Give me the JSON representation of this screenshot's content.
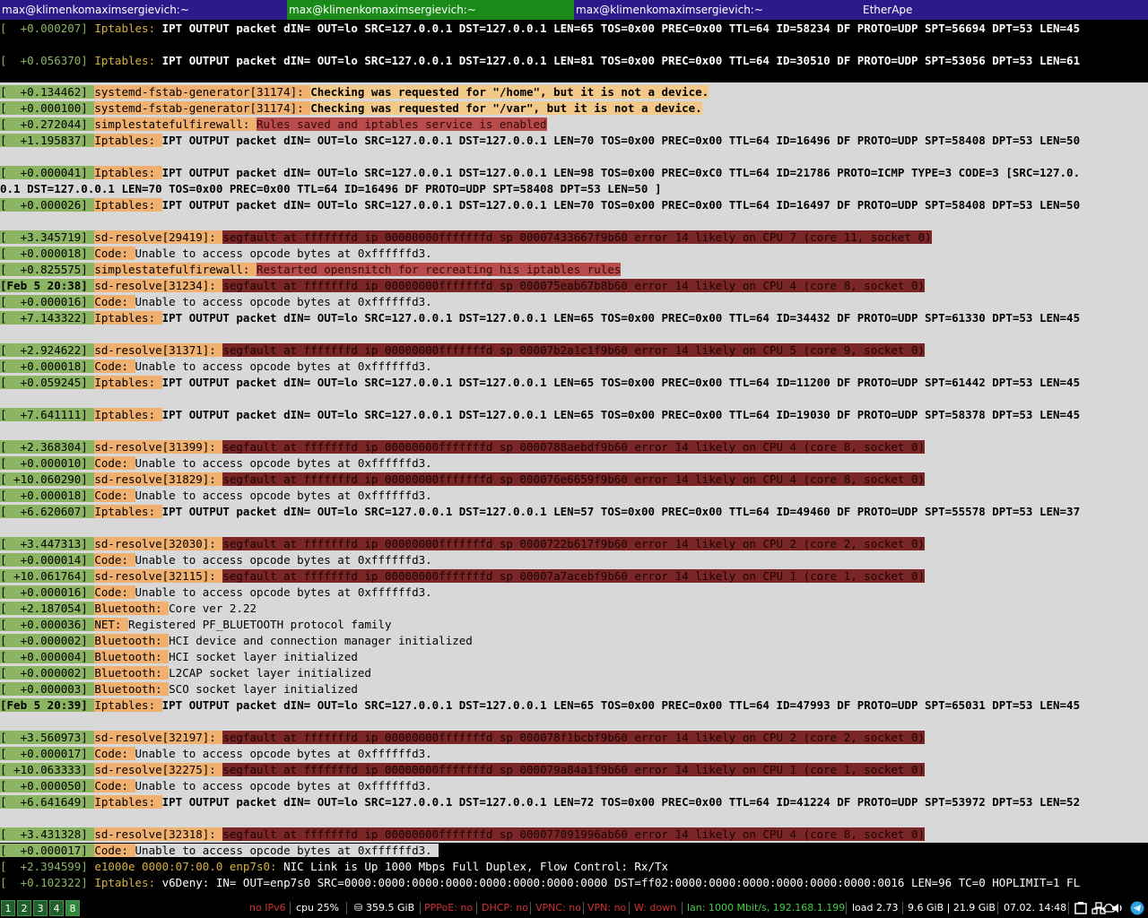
{
  "tabs": [
    {
      "title": "max@klimenkomaximsergievich:~"
    },
    {
      "title": "max@klimenkomaximsergievich:~"
    },
    {
      "title": "max@klimenkomaximsergievich:~"
    },
    {
      "title": "EtherApe"
    }
  ],
  "log": {
    "l0": {
      "ts": "[  +0.000207] ",
      "fac": "Iptables: ",
      "msg": "IPT OUTPUT packet dIN= OUT=lo SRC=127.0.0.1 DST=127.0.0.1 LEN=65 TOS=0x00 PREC=0x00 TTL=64 ID=58234 DF PROTO=UDP SPT=56694 DPT=53 LEN=45"
    },
    "l1": {
      "ts": "[  +0.056370] ",
      "fac": "Iptables: ",
      "msg": "IPT OUTPUT packet dIN= OUT=lo SRC=127.0.0.1 DST=127.0.0.1 LEN=81 TOS=0x00 PREC=0x00 TTL=64 ID=30510 DF PROTO=UDP SPT=53056 DPT=53 LEN=61"
    },
    "l2": {
      "ts": "[  +0.134462] ",
      "fac": "systemd-fstab-generator[31174]: ",
      "msg": "Checking was requested for \"/home\", but it is not a device."
    },
    "l3": {
      "ts": "[  +0.000100] ",
      "fac": "systemd-fstab-generator[31174]: ",
      "msg": "Checking was requested for \"/var\", but it is not a device."
    },
    "l4": {
      "ts": "[  +0.272044] ",
      "fac": "simplestatefulfirewall: ",
      "msg": "Rules saved and iptables service is enabled"
    },
    "l5": {
      "ts": "[  +1.195837] ",
      "fac": "Iptables: ",
      "msg": "IPT OUTPUT packet dIN= OUT=lo SRC=127.0.0.1 DST=127.0.0.1 LEN=70 TOS=0x00 PREC=0x00 TTL=64 ID=16496 DF PROTO=UDP SPT=58408 DPT=53 LEN=50"
    },
    "l6": {
      "ts": "[  +0.000041] ",
      "fac": "Iptables: ",
      "msg": "IPT OUTPUT packet dIN= OUT=lo SRC=127.0.0.1 DST=127.0.0.1 LEN=98 TOS=0x00 PREC=0xC0 TTL=64 ID=21786 PROTO=ICMP TYPE=3 CODE=3 [SRC=127.0."
    },
    "l6b": {
      "msg": "0.1 DST=127.0.0.1 LEN=70 TOS=0x00 PREC=0x00 TTL=64 ID=16496 DF PROTO=UDP SPT=58408 DPT=53 LEN=50 ]"
    },
    "l7": {
      "ts": "[  +0.000026] ",
      "fac": "Iptables: ",
      "msg": "IPT OUTPUT packet dIN= OUT=lo SRC=127.0.0.1 DST=127.0.0.1 LEN=70 TOS=0x00 PREC=0x00 TTL=64 ID=16497 DF PROTO=UDP SPT=58408 DPT=53 LEN=50"
    },
    "l8": {
      "ts": "[  +3.345719] ",
      "fac": "sd-resolve[29419]: ",
      "msg": "segfault at fffffffd ip 00000000fffffffd sp 00007433667f9b60 error 14 likely on CPU 7 (core 11, socket 0)"
    },
    "l9": {
      "ts": "[  +0.000018] ",
      "fac": "Code: ",
      "msg": "Unable to access opcode bytes at 0xffffffd3."
    },
    "l10": {
      "ts": "[  +0.825575] ",
      "fac": "simplestatefulfirewall: ",
      "msg": "Restarted opensnitch for recreating his iptables rules"
    },
    "l11": {
      "ts": "[Feb 5 20:38] ",
      "fac": "sd-resolve[31234]: ",
      "msg": "segfault at fffffffd ip 00000000fffffffd sp 000075eab67b8b60 error 14 likely on CPU 4 (core 8, socket 0)"
    },
    "l12": {
      "ts": "[  +0.000016] ",
      "fac": "Code: ",
      "msg": "Unable to access opcode bytes at 0xffffffd3."
    },
    "l13": {
      "ts": "[  +7.143322] ",
      "fac": "Iptables: ",
      "msg": "IPT OUTPUT packet dIN= OUT=lo SRC=127.0.0.1 DST=127.0.0.1 LEN=65 TOS=0x00 PREC=0x00 TTL=64 ID=34432 DF PROTO=UDP SPT=61330 DPT=53 LEN=45"
    },
    "l14": {
      "ts": "[  +2.924622] ",
      "fac": "sd-resolve[31371]: ",
      "msg": "segfault at fffffffd ip 00000000fffffffd sp 00007b2a1c1f9b60 error 14 likely on CPU 5 (core 9, socket 0)"
    },
    "l15": {
      "ts": "[  +0.000018] ",
      "fac": "Code: ",
      "msg": "Unable to access opcode bytes at 0xffffffd3."
    },
    "l16": {
      "ts": "[  +0.059245] ",
      "fac": "Iptables: ",
      "msg": "IPT OUTPUT packet dIN= OUT=lo SRC=127.0.0.1 DST=127.0.0.1 LEN=65 TOS=0x00 PREC=0x00 TTL=64 ID=11200 DF PROTO=UDP SPT=61442 DPT=53 LEN=45"
    },
    "l17": {
      "ts": "[  +7.641111] ",
      "fac": "Iptables: ",
      "msg": "IPT OUTPUT packet dIN= OUT=lo SRC=127.0.0.1 DST=127.0.0.1 LEN=65 TOS=0x00 PREC=0x00 TTL=64 ID=19030 DF PROTO=UDP SPT=58378 DPT=53 LEN=45"
    },
    "l18": {
      "ts": "[  +2.368304] ",
      "fac": "sd-resolve[31399]: ",
      "msg": "segfault at fffffffd ip 00000000fffffffd sp 0000788aebdf9b60 error 14 likely on CPU 4 (core 8, socket 0)"
    },
    "l19": {
      "ts": "[  +0.000010] ",
      "fac": "Code: ",
      "msg": "Unable to access opcode bytes at 0xffffffd3."
    },
    "l20": {
      "ts": "[ +10.060290] ",
      "fac": "sd-resolve[31829]: ",
      "msg": "segfault at fffffffd ip 00000000fffffffd sp 000076e6659f9b60 error 14 likely on CPU 4 (core 8, socket 0)"
    },
    "l21": {
      "ts": "[  +0.000018] ",
      "fac": "Code: ",
      "msg": "Unable to access opcode bytes at 0xffffffd3."
    },
    "l22": {
      "ts": "[  +6.620607] ",
      "fac": "Iptables: ",
      "msg": "IPT OUTPUT packet dIN= OUT=lo SRC=127.0.0.1 DST=127.0.0.1 LEN=57 TOS=0x00 PREC=0x00 TTL=64 ID=49460 DF PROTO=UDP SPT=55578 DPT=53 LEN=37"
    },
    "l23": {
      "ts": "[  +3.447313] ",
      "fac": "sd-resolve[32030]: ",
      "msg": "segfault at fffffffd ip 00000000fffffffd sp 0000722b617f9b60 error 14 likely on CPU 2 (core 2, socket 0)"
    },
    "l24": {
      "ts": "[  +0.000014] ",
      "fac": "Code: ",
      "msg": "Unable to access opcode bytes at 0xffffffd3."
    },
    "l25": {
      "ts": "[ +10.061764] ",
      "fac": "sd-resolve[32115]: ",
      "msg": "segfault at fffffffd ip 00000000fffffffd sp 00007a7acebf9b60 error 14 likely on CPU 1 (core 1, socket 0)"
    },
    "l26": {
      "ts": "[  +0.000016] ",
      "fac": "Code: ",
      "msg": "Unable to access opcode bytes at 0xffffffd3."
    },
    "l27": {
      "ts": "[  +2.187054] ",
      "fac": "Bluetooth: ",
      "msg": "Core ver 2.22"
    },
    "l28": {
      "ts": "[  +0.000036] ",
      "fac": "NET: ",
      "msg": "Registered PF_BLUETOOTH protocol family"
    },
    "l29": {
      "ts": "[  +0.000002] ",
      "fac": "Bluetooth: ",
      "msg": "HCI device and connection manager initialized"
    },
    "l30": {
      "ts": "[  +0.000004] ",
      "fac": "Bluetooth: ",
      "msg": "HCI socket layer initialized"
    },
    "l31": {
      "ts": "[  +0.000002] ",
      "fac": "Bluetooth: ",
      "msg": "L2CAP socket layer initialized"
    },
    "l32": {
      "ts": "[  +0.000003] ",
      "fac": "Bluetooth: ",
      "msg": "SCO socket layer initialized"
    },
    "l33": {
      "ts": "[Feb 5 20:39] ",
      "fac": "Iptables: ",
      "msg": "IPT OUTPUT packet dIN= OUT=lo SRC=127.0.0.1 DST=127.0.0.1 LEN=65 TOS=0x00 PREC=0x00 TTL=64 ID=47993 DF PROTO=UDP SPT=65031 DPT=53 LEN=45"
    },
    "l34": {
      "ts": "[  +3.560973] ",
      "fac": "sd-resolve[32197]: ",
      "msg": "segfault at fffffffd ip 00000000fffffffd sp 000078f1bcbf9b60 error 14 likely on CPU 2 (core 2, socket 0)"
    },
    "l35": {
      "ts": "[  +0.000017] ",
      "fac": "Code: ",
      "msg": "Unable to access opcode bytes at 0xffffffd3."
    },
    "l36": {
      "ts": "[ +10.063333] ",
      "fac": "sd-resolve[32275]: ",
      "msg": "segfault at fffffffd ip 00000000fffffffd sp 000079a84a1f9b60 error 14 likely on CPU 1 (core 1, socket 0)"
    },
    "l37": {
      "ts": "[  +0.000050] ",
      "fac": "Code: ",
      "msg": "Unable to access opcode bytes at 0xffffffd3."
    },
    "l38": {
      "ts": "[  +6.641649] ",
      "fac": "Iptables: ",
      "msg": "IPT OUTPUT packet dIN= OUT=lo SRC=127.0.0.1 DST=127.0.0.1 LEN=72 TOS=0x00 PREC=0x00 TTL=64 ID=41224 DF PROTO=UDP SPT=53972 DPT=53 LEN=52"
    },
    "l39": {
      "ts": "[  +3.431328] ",
      "fac": "sd-resolve[32318]: ",
      "msg": "segfault at fffffffd ip 00000000fffffffd sp 000077091996ab60 error 14 likely on CPU 4 (core 8, socket 0)"
    },
    "l40": {
      "ts": "[  +0.000017] ",
      "fac": "Code: ",
      "msg": "Unable to access opcode bytes at 0xffffffd3. "
    },
    "l41": {
      "ts": "[  +2.394599] ",
      "fac": "e1000e 0000:07:00.0 enp7s0: ",
      "msg": "NIC Link is Up 1000 Mbps Full Duplex, Flow Control: Rx/Tx"
    },
    "l42": {
      "ts": "[  +0.102322] ",
      "fac": "Iptables: ",
      "msg": "v6Deny: IN= OUT=enp7s0 SRC=0000:0000:0000:0000:0000:0000:0000:0000 DST=ff02:0000:0000:0000:0000:0000:0000:0016 LEN=96 TC=0 HOPLIMIT=1 FL"
    }
  },
  "statusbar": {
    "workspaces": [
      "1",
      "2",
      "3",
      "4",
      "8"
    ],
    "ipv6": "no IPv6",
    "cpu": "cpu  25%",
    "disk": "359.5 GiB",
    "pppoe": "PPPoE: no",
    "dhcp": "DHCP: no",
    "vpnc": "VPNC: no",
    "vpn": "VPN: no",
    "wifi": "W: down",
    "lan": "lan: 1000 Mbit/s, 192.168.1.199",
    "load": "load 2.73",
    "mem": "9.6 GiB | 21.9 GiB",
    "datetime": "07.02. 14:48"
  },
  "colors": {
    "timestamp_bg": "#8bb463",
    "facility_bg": "#f0b070",
    "error_bg": "#7a2626",
    "alert_bg": "#b84b4b",
    "terminal_bg": "#d8d8d8"
  },
  "icons": [
    "disk-icon",
    "clipboard-icon",
    "network-icon",
    "cloud-icon",
    "volume-icon",
    "telegram-icon"
  ]
}
